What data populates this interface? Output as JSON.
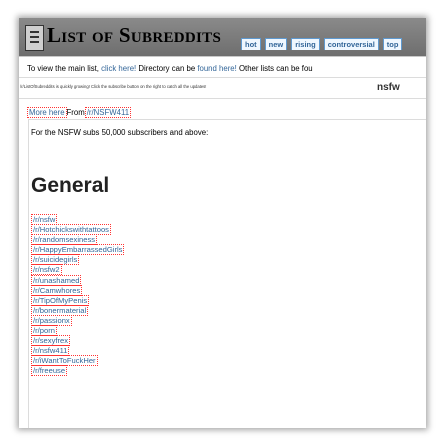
{
  "header": {
    "title": "List of Subreddits",
    "tabs": [
      "hot",
      "new",
      "rising",
      "controversial",
      "top"
    ]
  },
  "info_bar": {
    "text1": "To view the main list,",
    "link1": "click here!",
    "text2": "Directory can be",
    "link2": "found here!",
    "text3": "Other lists can be fou"
  },
  "notice": {
    "text": "/r/ListOfSubreddits is quickly growing! Click the subscribe button on the right to catch all the updates!",
    "nsfw_label": "nsfw"
  },
  "more_bar": {
    "more_link": "More here",
    "from_text": "From",
    "source_link": "/r/NSFW411"
  },
  "post": {
    "intro": "For the NSFW subs 50,000 subscribers and above:",
    "section_heading": "General",
    "subreddits": [
      "/r/nsfw",
      "/r/Hotchickswithtattoos",
      "/r/randomsexiness",
      "/r/HappyEmbarrassedGirls",
      "/r/suicidegirls",
      "/r/nsfw2",
      "/r/unashamed",
      "/r/Camwhores",
      "/r/TipOfMyPenis",
      "/r/bonermaterial",
      "/r/passionx",
      "/r/porn",
      "/r/sexyfrex",
      "/r/nsfw411",
      "/r/iWantToFuckHer",
      "/r/freeuse"
    ]
  },
  "colors": {
    "header_bg": "#7b7b7b",
    "link": "#336699",
    "tab_bg": "#eff7ff",
    "dotted_border": "#ff3333"
  }
}
